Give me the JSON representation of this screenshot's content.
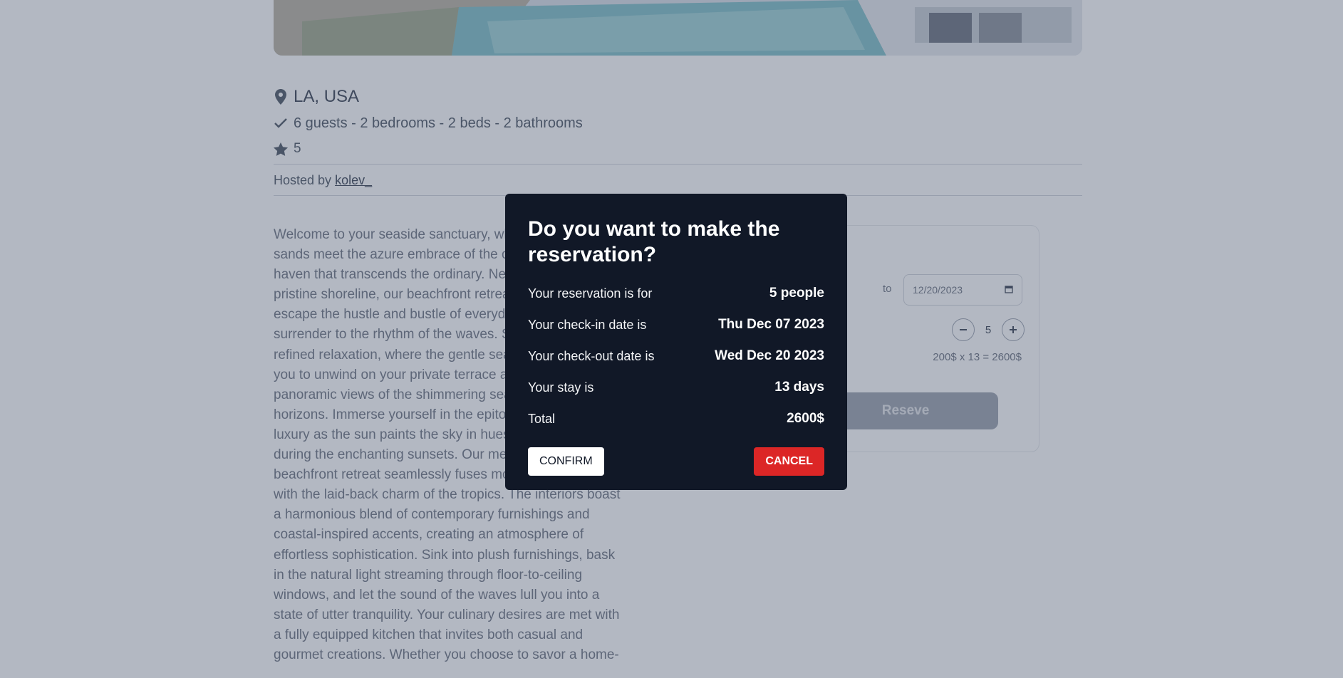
{
  "listing": {
    "location": "LA, USA",
    "specs": "6 guests - 2 bedrooms - 2 beds - 2 bathrooms",
    "rating": "5",
    "hosted_by_label": "Hosted by",
    "host_name": "kolev_",
    "description": "Welcome to your seaside sanctuary, where sun-kissed sands meet the azure embrace of the ocean in a coastal haven that transcends the ordinary. Nestled along the pristine shoreline, our beachfront retreat invites you to escape the hustle and bustle of everyday life and surrender to the rhythm of the waves. Step into a world of refined relaxation, where the gentle sea breeze invites you to unwind on your private terrace adorned with panoramic views of the shimmering sea and endless horizons. Immerse yourself in the epitome of coastal luxury as the sun paints the sky in hues of pink and gold during the enchanting sunsets. Our meticulously designed beachfront retreat seamlessly fuses modern elegance with the laid-back charm of the tropics. The interiors boast a harmonious blend of contemporary furnishings and coastal-inspired accents, creating an atmosphere of effortless sophistication. Sink into plush furnishings, bask in the natural light streaming through floor-to-ceiling windows, and let the sound of the waves lull you into a state of utter tranquility. Your culinary desires are met with a fully equipped kitchen that invites both casual and gourmet creations. Whether you choose to savor a home-"
  },
  "booking": {
    "checkout_value": "12/20/2023",
    "to_label": "to",
    "guests": "5",
    "calc": "200$ x 13 = 2600$",
    "reserve_label": "Reseve"
  },
  "modal": {
    "title": "Do you want to make the reservation?",
    "rows": [
      {
        "label": "Your reservation is for",
        "value": "5 people"
      },
      {
        "label": "Your check-in date is",
        "value": "Thu Dec 07 2023"
      },
      {
        "label": "Your check-out date is",
        "value": "Wed Dec 20 2023"
      },
      {
        "label": "Your stay is",
        "value": "13 days"
      },
      {
        "label": "Total",
        "value": "2600$"
      }
    ],
    "confirm_label": "CONFIRM",
    "cancel_label": "CANCEL"
  },
  "icons": {
    "location": "map-pin-icon",
    "specs": "check-icon",
    "rating": "star-icon",
    "calendar": "calendar-icon"
  },
  "colors": {
    "modal_bg": "#111827",
    "cancel": "#dc2626",
    "confirm": "#ffffff"
  }
}
